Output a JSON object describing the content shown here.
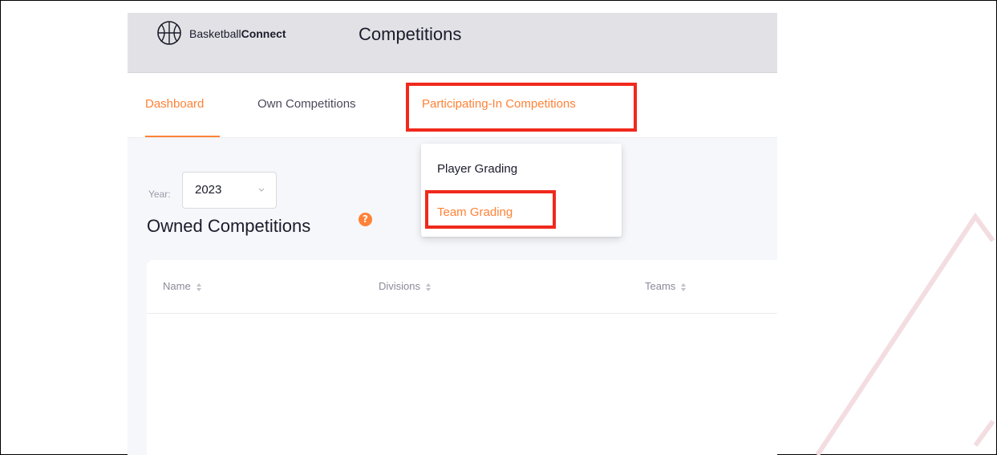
{
  "brand": {
    "name_regular": "Basketball",
    "name_bold": "Connect",
    "logo_icon": "basketball-icon"
  },
  "header": {
    "title": "Competitions"
  },
  "tabs": [
    {
      "label": "Dashboard",
      "active": true
    },
    {
      "label": "Own Competitions",
      "active": false
    },
    {
      "label": "Participating-In Competitions",
      "active": true
    }
  ],
  "dropdown": {
    "items": [
      {
        "label": "Player Grading",
        "active": false
      },
      {
        "label": "Team Grading",
        "active": true
      }
    ]
  },
  "filters": {
    "year_label": "Year:",
    "year_value": "2023"
  },
  "section": {
    "title": "Owned Competitions",
    "help_icon": "?"
  },
  "table": {
    "columns": [
      {
        "label": "Name"
      },
      {
        "label": "Divisions"
      },
      {
        "label": "Teams"
      }
    ],
    "rows": []
  },
  "colors": {
    "accent": "#ff8237",
    "highlight": "#f0291c",
    "header_bg": "#e2e2e6",
    "text": "#1b1b2b"
  }
}
